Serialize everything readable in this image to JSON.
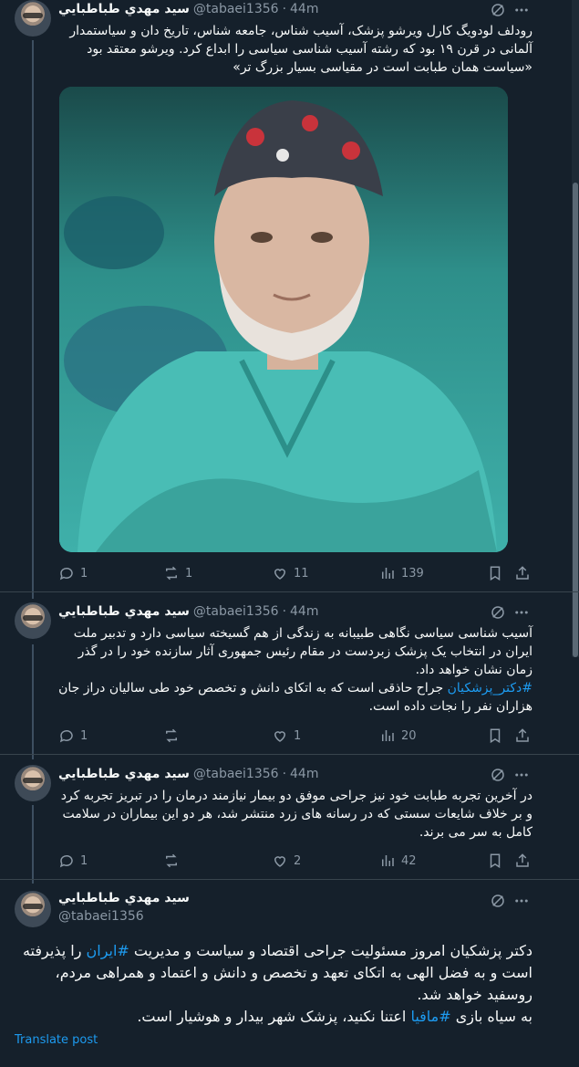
{
  "user": {
    "name": "سید مهدي طباطبايي",
    "handle": "@tabaei1356",
    "separator": "·"
  },
  "posts": [
    {
      "time": "44m",
      "text": "رودلف لودویگ کارل ویرشو پزشک، آسیب شناس، جامعه شناس، تاریخ دان و سیاستمدار آلمانی در قرن ۱۹ بود که رشته آسیب شناسی سیاسی را ابداع کرد. ویرشو معتقد بود «سیاست همان طبابت است در مقیاسی بسیار بزرگ تر»",
      "replies": "1",
      "reposts": "1",
      "likes": "11",
      "views": "139"
    },
    {
      "time": "44m",
      "text_main": "آسیب شناسی سیاسی نگاهی طبیبانه به زندگی از هم گسیخته سیاسی دارد و تدبیر ملت ایران در انتخاب یک پزشک زبردست در مقام رئیس جمهوری آثار سازنده خود را در گذر زمان نشان خواهد داد.",
      "hashtag": "#دکتر_پزشکیان",
      "text_after": " جراح حاذقی است که به اتکای دانش و تخصص خود طی سالیان دراز جان هزاران نفر را نجات داده است.",
      "replies": "1",
      "reposts": "",
      "likes": "1",
      "views": "20"
    },
    {
      "time": "44m",
      "text": "در آخرین تجربه طبابت خود نیز جراحی موفق دو بیمار نیازمند درمان را در تبریز تجربه کرد و بر خلاف شایعات سستی که در رسانه های زرد منتشر شد، هر دو این بیماران در سلامت کامل به سر می برند.",
      "replies": "1",
      "reposts": "",
      "likes": "2",
      "views": "42"
    },
    {
      "line1_before": "دکتر پزشکیان امروز مسئولیت جراحی اقتصاد و سیاست و مدیریت ",
      "hashtag1": "#ایران",
      "line1_after": " را پذیرفته است و به فضل الهی به اتکای تعهد و تخصص و دانش و اعتماد و همراهی مردم، روسفید خواهد شد.",
      "line2_before": "به سیاه بازی ",
      "hashtag2": "#مافیا",
      "line2_after": " اعتنا نکنید، پزشک شهر بیدار و هوشیار است."
    }
  ],
  "translate_label": "Translate post",
  "icons": {
    "grok": "grok-icon",
    "more": "more-icon",
    "reply": "reply-icon",
    "repost": "repost-icon",
    "like": "like-icon",
    "views": "views-icon",
    "bookmark": "bookmark-icon",
    "share": "share-icon"
  },
  "colors": {
    "background": "#15202b",
    "text": "#f7f9f9",
    "muted": "#8b98a5",
    "accent": "#1d9bf0"
  }
}
